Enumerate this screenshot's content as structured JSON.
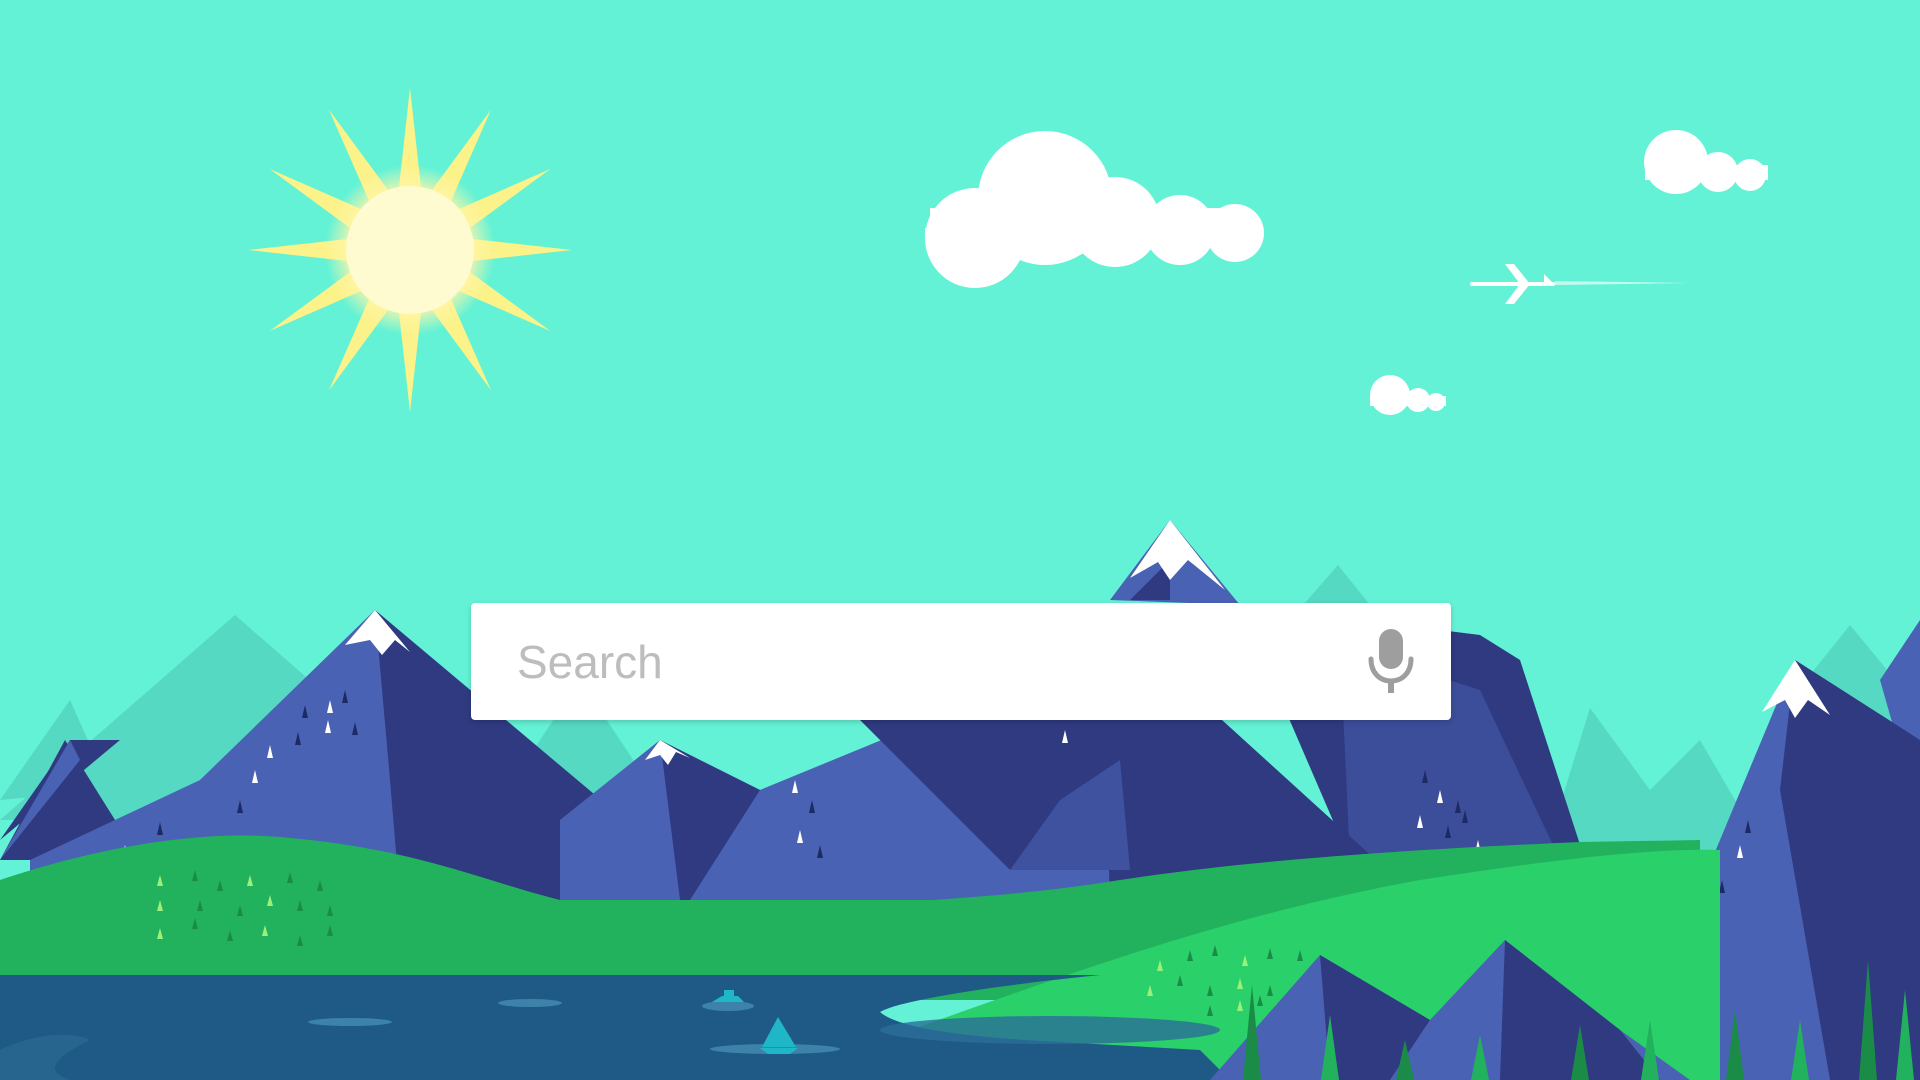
{
  "search": {
    "placeholder": "Search",
    "value": ""
  },
  "icons": {
    "mic": "microphone-icon"
  },
  "colors": {
    "sky": "#64f2d6",
    "sun_rays": "#fbf28a",
    "sun_core": "#fffbd0",
    "cloud": "#ffffff",
    "mountain_light": "#4a62b4",
    "mountain_dark": "#2f3a80",
    "snow": "#ffffff",
    "distant_mountain": "#55d9c2",
    "hill_green": "#22b25e",
    "hill_light_green": "#2ad06a",
    "lake": "#1f5a86",
    "mic_icon": "#9e9e9e"
  }
}
